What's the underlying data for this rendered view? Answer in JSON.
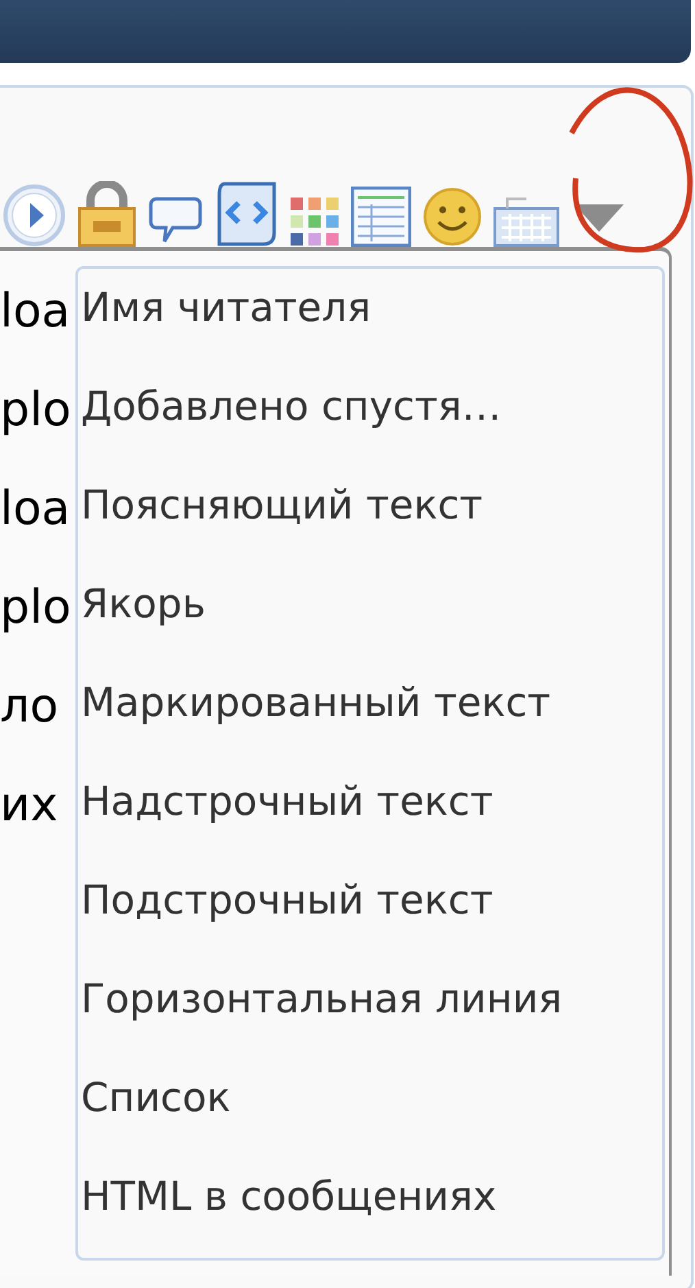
{
  "editor_rows": [
    "loa",
    "plo",
    "loa",
    "plo",
    "ло",
    "их"
  ],
  "dropdown_menu": {
    "items": [
      {
        "label": "Имя читателя"
      },
      {
        "label": "Добавлено спустя…"
      },
      {
        "label": "Поясняющий текст"
      },
      {
        "label": "Якорь"
      },
      {
        "label": "Маркированный текст"
      },
      {
        "label": "Надстрочный текст"
      },
      {
        "label": "Подстрочный текст"
      },
      {
        "label": "Горизонтальная линия"
      },
      {
        "label": "Список"
      },
      {
        "label": "HTML в сообщениях"
      }
    ]
  }
}
